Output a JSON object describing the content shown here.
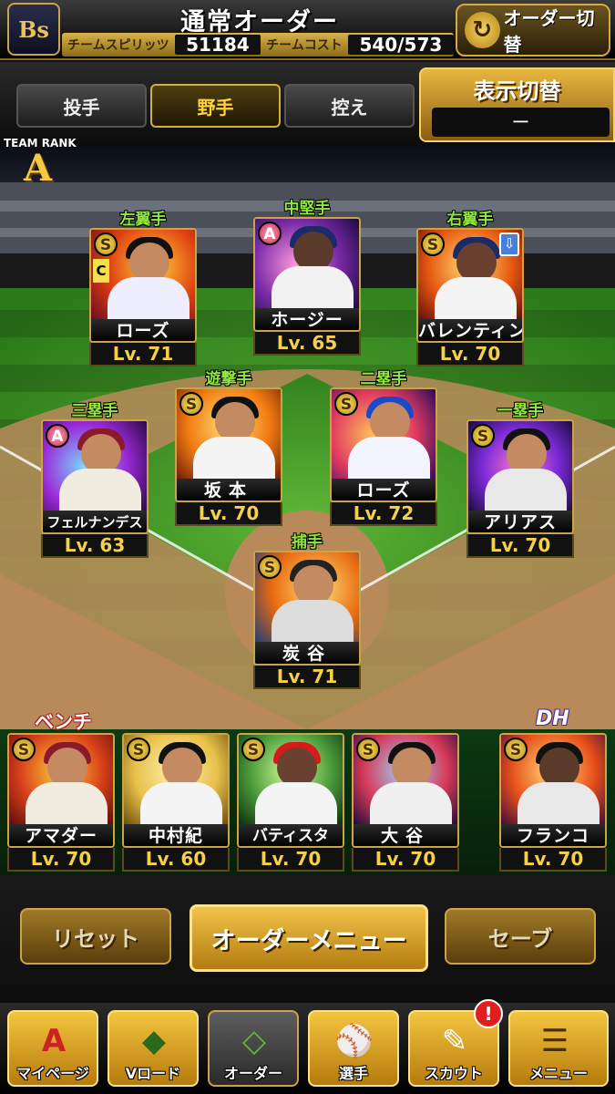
{
  "header": {
    "logo": "Bs",
    "title": "通常オーダー",
    "team_spirit_label": "チームスピリッツ",
    "team_spirit_value": "51184",
    "team_cost_label": "チームコスト",
    "team_cost_value": "540/573",
    "order_switch_label": "オーダー切替",
    "order_switch_icon": "refresh-icon"
  },
  "tabs": [
    "投手",
    "野手",
    "控え"
  ],
  "active_tab": "野手",
  "display_switch": {
    "label": "表示切替",
    "value": "ー"
  },
  "team_rank": {
    "label": "TEAM RANK",
    "value": "A"
  },
  "lineup": [
    {
      "position": "左翼手",
      "name": "ローズ",
      "level": "Lv. 71",
      "rank": "S",
      "captain": "C"
    },
    {
      "position": "中堅手",
      "name": "ホージー",
      "level": "Lv. 65",
      "rank": "A"
    },
    {
      "position": "右翼手",
      "name": "バレンティン",
      "level": "Lv. 70",
      "rank": "S",
      "updown": "⇩"
    },
    {
      "position": "三塁手",
      "name": "フェルナンデス",
      "level": "Lv. 63",
      "rank": "A"
    },
    {
      "position": "遊撃手",
      "name": "坂本",
      "level": "Lv. 70",
      "rank": "S"
    },
    {
      "position": "二塁手",
      "name": "ローズ",
      "level": "Lv. 72",
      "rank": "S"
    },
    {
      "position": "一塁手",
      "name": "アリアス",
      "level": "Lv. 70",
      "rank": "S"
    },
    {
      "position": "捕手",
      "name": "炭谷",
      "level": "Lv. 71",
      "rank": "S"
    }
  ],
  "bench_label": "ベンチ",
  "bench": [
    {
      "name": "アマダー",
      "level": "Lv. 70",
      "rank": "S"
    },
    {
      "name": "中村紀",
      "level": "Lv. 60",
      "rank": "S"
    },
    {
      "name": "バティスタ",
      "level": "Lv. 70",
      "rank": "S"
    },
    {
      "name": "大谷",
      "level": "Lv. 70",
      "rank": "S"
    }
  ],
  "dh_label": "DH",
  "dh": {
    "name": "フランコ",
    "level": "Lv. 70",
    "rank": "S"
  },
  "buttons": {
    "reset": "リセット",
    "order_menu": "オーダーメニュー",
    "save": "セーブ"
  },
  "nav": [
    {
      "label": "マイページ",
      "icon": "mypage-icon"
    },
    {
      "label": "Vロード",
      "icon": "stadium-icon"
    },
    {
      "label": "オーダー",
      "icon": "field-icon"
    },
    {
      "label": "選手",
      "icon": "player-icon"
    },
    {
      "label": "スカウト",
      "icon": "scout-icon"
    },
    {
      "label": "メニュー",
      "icon": "menu-icon"
    }
  ],
  "notification_badge": "!"
}
